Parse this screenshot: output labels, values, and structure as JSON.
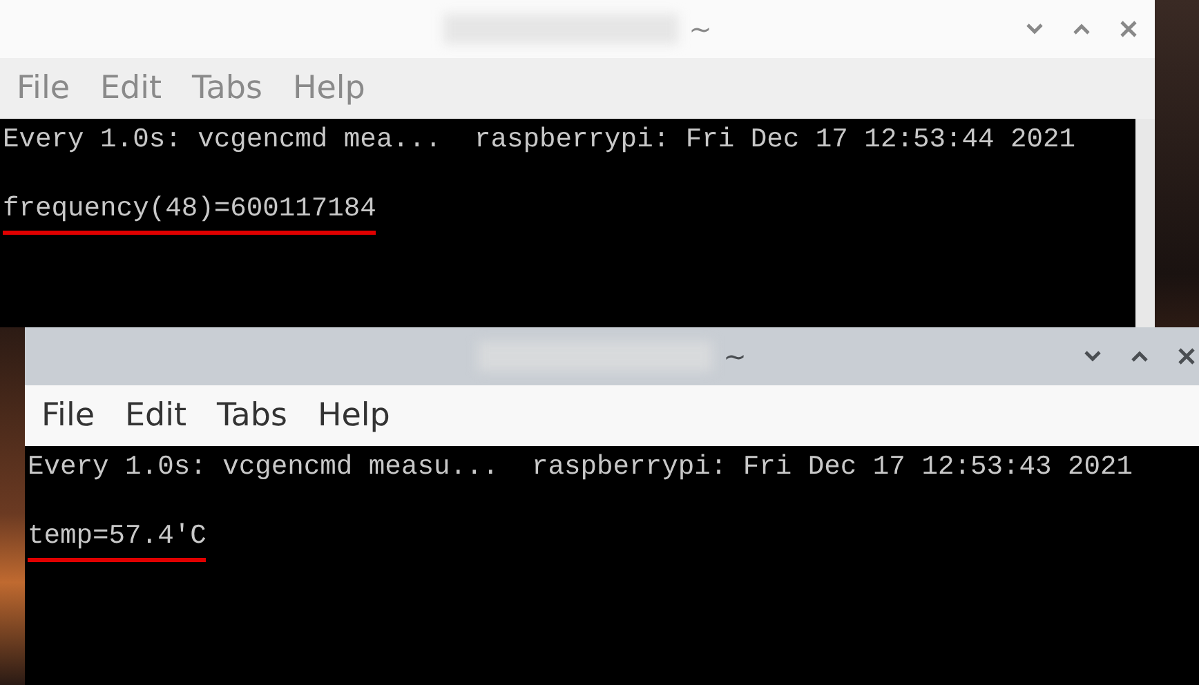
{
  "windows": [
    {
      "title": "~",
      "active": false,
      "menu": [
        "File",
        "Edit",
        "Tabs",
        "Help"
      ],
      "terminal": {
        "header": "Every 1.0s: vcgencmd mea...",
        "host": "raspberrypi: Fri Dec 17 12:53:44 2021",
        "output": "frequency(48)=600117184",
        "underlined": true
      }
    },
    {
      "title": "~",
      "active": true,
      "menu": [
        "File",
        "Edit",
        "Tabs",
        "Help"
      ],
      "terminal": {
        "header": "Every 1.0s: vcgencmd measu...",
        "host": "raspberrypi: Fri Dec 17 12:53:43 2021",
        "output": "temp=57.4'C",
        "underlined": true
      }
    }
  ]
}
